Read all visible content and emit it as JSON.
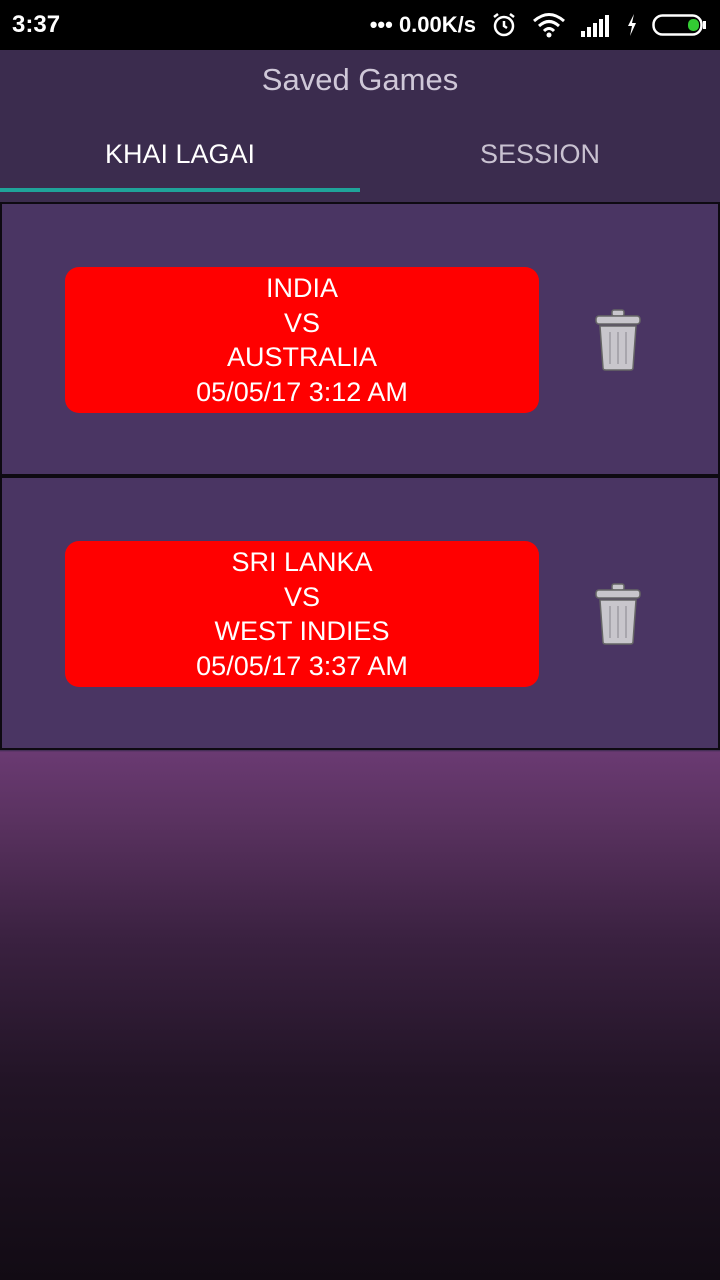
{
  "status_bar": {
    "time": "3:37",
    "network_speed": "0.00K/s",
    "dots": "•••",
    "icons": [
      "alarm-icon",
      "wifi-icon",
      "signal-icon",
      "charging-icon",
      "battery-icon"
    ],
    "battery_color": "#33cc33"
  },
  "header": {
    "title": "Saved Games",
    "tabs": [
      {
        "label": "KHAI LAGAI",
        "active": true
      },
      {
        "label": "SESSION",
        "active": false
      }
    ],
    "accent_color": "#1fa39a"
  },
  "games": [
    {
      "team1": "INDIA",
      "vs": "VS",
      "team2": "AUSTRALIA",
      "datetime": "05/05/17 3:12 AM"
    },
    {
      "team1": "SRI LANKA",
      "vs": "VS",
      "team2": "WEST INDIES",
      "datetime": "05/05/17 3:37 AM"
    }
  ],
  "colors": {
    "header_bg": "#3b2c4e",
    "card_bg": "#4a3563",
    "match_button": "#ff0000"
  }
}
